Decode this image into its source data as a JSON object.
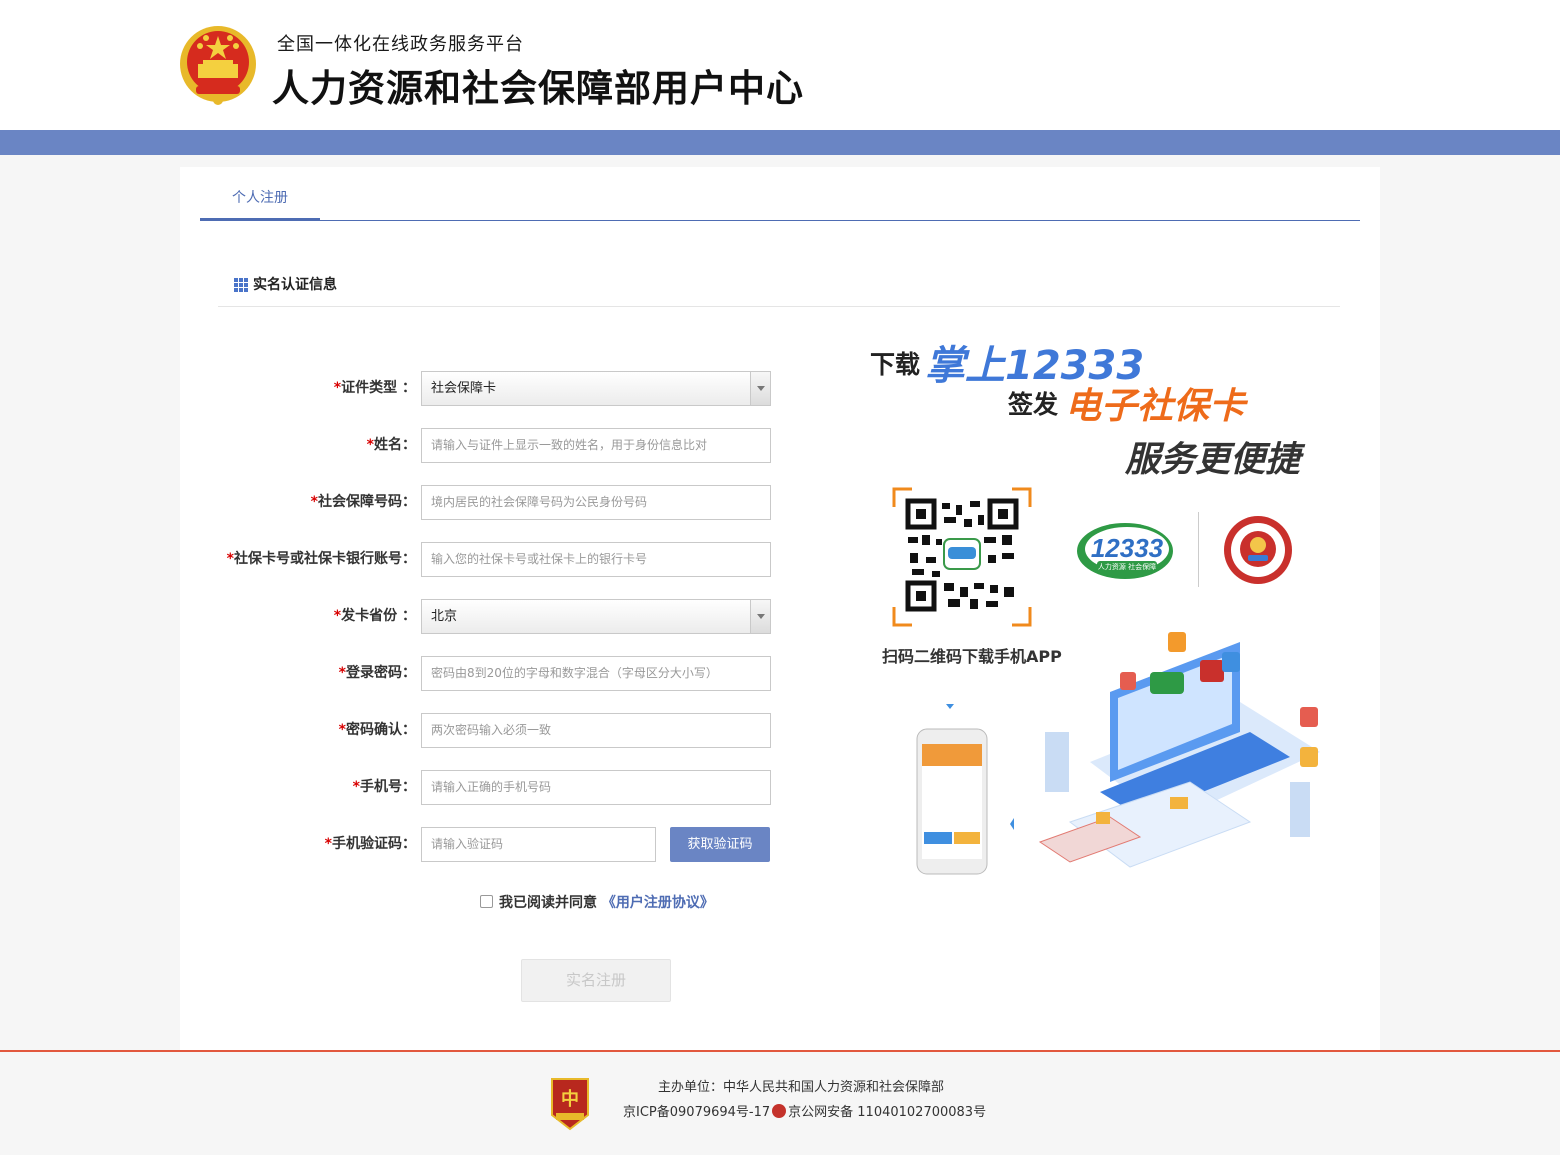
{
  "header": {
    "subtitle": "全国一体化在线政务服务平台",
    "title": "人力资源和社会保障部用户中心"
  },
  "tabs": [
    {
      "label": "个人注册",
      "active": true
    }
  ],
  "section": {
    "title": "实名认证信息"
  },
  "form": {
    "required_mark": "*",
    "cert_type": {
      "label": "证件类型 ：",
      "value": "社会保障卡"
    },
    "name": {
      "label": "姓名：",
      "placeholder": "请输入与证件上显示一致的姓名，用于身份信息比对"
    },
    "ss_number": {
      "label": "社会保障号码：",
      "placeholder": "境内居民的社会保障号码为公民身份号码"
    },
    "card_number": {
      "label": "社保卡号或社保卡银行账号：",
      "placeholder": "输入您的社保卡号或社保卡上的银行卡号"
    },
    "province": {
      "label": "发卡省份 ：",
      "value": "北京"
    },
    "password": {
      "label": "登录密码：",
      "placeholder": "密码由8到20位的字母和数字混合（字母区分大小写）"
    },
    "password_confirm": {
      "label": "密码确认：",
      "placeholder": "两次密码输入必须一致"
    },
    "phone": {
      "label": "手机号：",
      "placeholder": "请输入正确的手机号码"
    },
    "sms_code": {
      "label": "手机验证码：",
      "placeholder": "请输入验证码",
      "button": "获取验证码"
    },
    "agree": {
      "text": "我已阅读并同意",
      "link": "《用户注册协议》",
      "checked": false
    },
    "submit": "实名注册"
  },
  "promo": {
    "download": "下载",
    "app_name": "掌上12333",
    "issue": "签发",
    "card": "电子社保卡",
    "slogan": "服务更便捷",
    "logo_text": "12333",
    "logo_sub": "人力资源 社会保障",
    "qr_caption": "扫码二维码下载手机APP"
  },
  "footer": {
    "sponsor": "主办单位：中华人民共和国人力资源和社会保障部",
    "icp": "京ICP备09079694号-17",
    "police": "京公网安备 11040102700083号"
  },
  "colors": {
    "accent": "#6a85c4",
    "tab": "#4e6cb3",
    "required": "#d80000",
    "footer_line": "#e2583e"
  }
}
